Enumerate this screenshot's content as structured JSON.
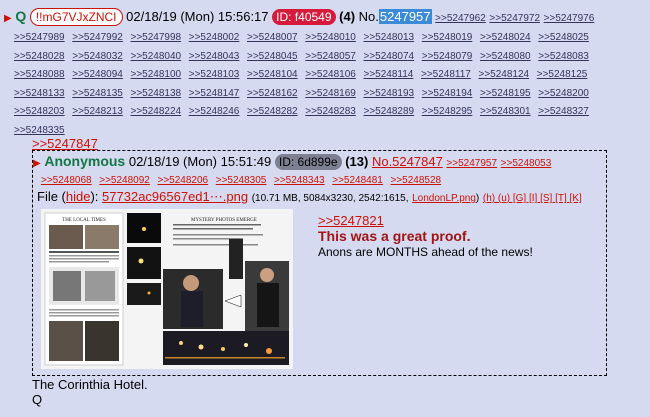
{
  "post": {
    "arrow": "▶",
    "name": "Q",
    "tripcode": "!!mG7VJxZNCI",
    "date": "02/18/19 (Mon) 15:56:17",
    "id": "ID: f40549",
    "reply_count": "(4)",
    "no_label": "No.",
    "post_number": "5247957",
    "replies": [
      ">>5247962",
      ">>5247972",
      ">>5247976",
      ">>5247989",
      ">>5247992",
      ">>5247998",
      ">>5248002",
      ">>5248007",
      ">>5248010",
      ">>5248013",
      ">>5248019",
      ">>5248024",
      ">>5248025",
      ">>5248028",
      ">>5248032",
      ">>5248040",
      ">>5248043",
      ">>5248045",
      ">>5248057",
      ">>5248074",
      ">>5248079",
      ">>5248080",
      ">>5248083",
      ">>5248088",
      ">>5248094",
      ">>5248100",
      ">>5248103",
      ">>5248104",
      ">>5248106",
      ">>5248114",
      ">>5248117",
      ">>5248124",
      ">>5248125",
      ">>5248133",
      ">>5248135",
      ">>5248138",
      ">>5248147",
      ">>5248162",
      ">>5248169",
      ">>5248193",
      ">>5248194",
      ">>5248195",
      ">>5248200",
      ">>5248203",
      ">>5248213",
      ">>5248224",
      ">>5248246",
      ">>5248282",
      ">>5248283",
      ">>5248289",
      ">>5248295",
      ">>5248301",
      ">>5248327",
      ">>5248335"
    ],
    "quote_link": ">>5247847",
    "footer_line1": "The Corinthia Hotel.",
    "footer_line2": "Q"
  },
  "inline_post": {
    "arrow": "▶",
    "name": "Anonymous",
    "date": "02/18/19 (Mon) 15:51:49",
    "id": "ID: 6d899e",
    "reply_count": "(13)",
    "post_number": "No.5247847",
    "replies_row1": [
      ">>5247957",
      ">>5248053"
    ],
    "replies_row2": [
      ">>5248068",
      ">>5248092",
      ">>5248206",
      ">>5248305",
      ">>5248343",
      ">>5248481",
      ">>5248528"
    ],
    "file_label": "File (",
    "hide_label": "hide",
    "file_label_close": "):",
    "file_name": "57732ac96567ed1⋯.png",
    "file_meta_open": "(10.71 MB, 5084x3230, 2542:1615,",
    "orig_name": "LondonLP.png",
    "file_meta_close": ")",
    "tools": "(h) (u) [G] [I] [S] [T] [K]",
    "body_quote": ">>5247821",
    "body_bold": "This was a great proof.",
    "body_text": "Anons are MONTHS ahead of the news!",
    "thumb_newspaper": "THE LOCAL TIMES",
    "thumb_headline": "MYSTERY PHOTOS EMERGE"
  },
  "colors": {
    "background": "#d6daf0",
    "link": "#34345c",
    "red": "#cc1105",
    "name_green": "#117743",
    "id_badge": "#d61a3c",
    "highlight": "#3b8bd8"
  }
}
